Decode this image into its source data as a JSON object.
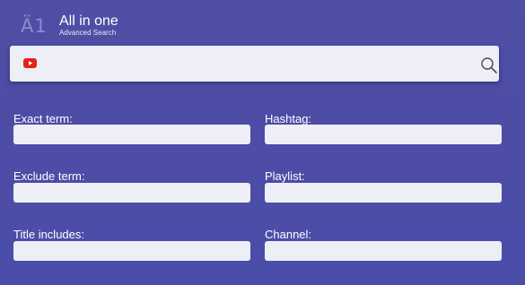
{
  "header": {
    "logo_text": "Ä1",
    "title": "All in one",
    "subtitle": "Advanced Search"
  },
  "search": {
    "value": "",
    "placeholder": "",
    "source_icon": "youtube-icon",
    "action_icon": "search-icon"
  },
  "fields": {
    "exact_term": {
      "label": "Exact term:",
      "value": ""
    },
    "hashtag": {
      "label": "Hashtag:",
      "value": ""
    },
    "exclude_term": {
      "label": "Exclude term:",
      "value": ""
    },
    "playlist": {
      "label": "Playlist:",
      "value": ""
    },
    "title_includes": {
      "label": "Title includes:",
      "value": ""
    },
    "channel": {
      "label": "Channel:",
      "value": ""
    }
  },
  "colors": {
    "background": "#4d4ca6",
    "input_background": "#eeeff6",
    "youtube_red": "#e62117",
    "logo": "#8a8ccf"
  }
}
